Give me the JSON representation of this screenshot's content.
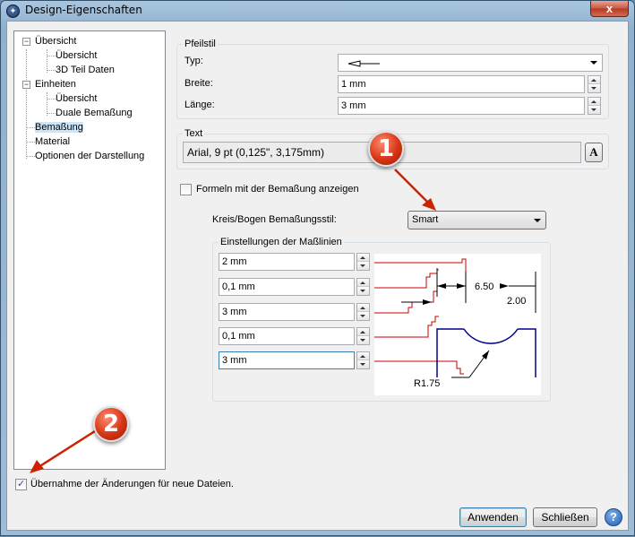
{
  "window": {
    "title": "Design-Eigenschaften",
    "close_label": "x"
  },
  "tree": {
    "items": [
      {
        "label": "Übersicht",
        "expander": "−"
      },
      {
        "label": "Übersicht"
      },
      {
        "label": "3D Teil Daten"
      },
      {
        "label": "Einheiten",
        "expander": "−"
      },
      {
        "label": "Übersicht"
      },
      {
        "label": "Duale Bemaßung"
      },
      {
        "label": "Bemaßung"
      },
      {
        "label": "Material"
      },
      {
        "label": "Optionen der Darstellung"
      }
    ]
  },
  "pfeilstil": {
    "title": "Pfeilstil",
    "typ_label": "Typ:",
    "breite_label": "Breite:",
    "breite_value": "1 mm",
    "laenge_label": "Länge:",
    "laenge_value": "3 mm"
  },
  "text_group": {
    "title": "Text",
    "font_value": "Arial, 9 pt (0,125\", 3,175mm)",
    "font_button": "A"
  },
  "formeln": {
    "label": "Formeln mit der Bemaßung anzeigen",
    "checked": false
  },
  "kreis": {
    "label": "Kreis/Bogen Bemaßungsstil:",
    "value": "Smart"
  },
  "masslinien": {
    "title": "Einstellungen der Maßlinien",
    "fields": [
      "2 mm",
      "0,1 mm",
      "3 mm",
      "0,1 mm",
      "3 mm"
    ],
    "diagram": {
      "dim1": "6.50",
      "dim2": "2.00",
      "radius": "R1.75"
    }
  },
  "uebernahme": {
    "label": "Übernahme der Änderungen für neue Dateien.",
    "checked": true
  },
  "buttons": {
    "apply": "Anwenden",
    "close": "Schließen",
    "help": "?"
  },
  "callouts": {
    "one": "1",
    "two": "2"
  },
  "colors": {
    "callout": "#d63515",
    "diagram_red": "#cc0000",
    "diagram_blue": "#00008b"
  }
}
